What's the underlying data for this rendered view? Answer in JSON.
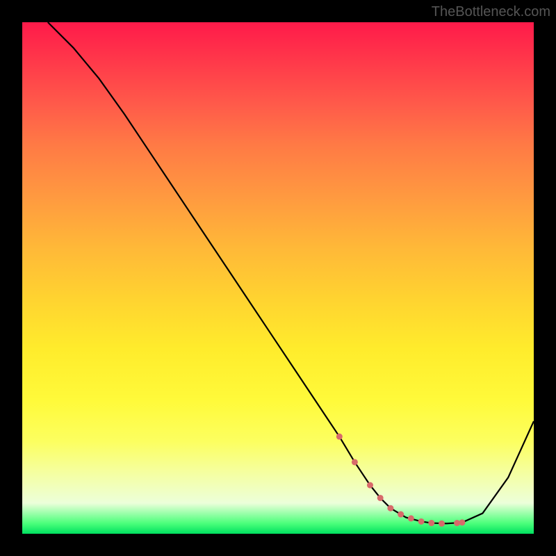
{
  "watermark": "TheBottleneck.com",
  "chart_data": {
    "type": "line",
    "title": "",
    "xlabel": "",
    "ylabel": "",
    "xlim": [
      0,
      100
    ],
    "ylim": [
      0,
      100
    ],
    "grid": false,
    "legend": false,
    "background": {
      "style": "vertical-gradient",
      "stops": [
        {
          "pos": 0,
          "color": "#ff1a4a"
        },
        {
          "pos": 50,
          "color": "#ffd330"
        },
        {
          "pos": 90,
          "color": "#f5ffa0"
        },
        {
          "pos": 100,
          "color": "#00e060"
        }
      ]
    },
    "series": [
      {
        "name": "bottleneck-curve",
        "color": "#000000",
        "x": [
          5,
          10,
          15,
          20,
          25,
          30,
          35,
          40,
          45,
          50,
          55,
          60,
          62,
          65,
          68,
          70,
          72,
          75,
          78,
          80,
          83,
          86,
          90,
          95,
          100
        ],
        "values": [
          100,
          95,
          89,
          82,
          74.5,
          67,
          59.5,
          52,
          44.5,
          37,
          29.5,
          22,
          19,
          14,
          9.5,
          7,
          5,
          3.2,
          2.4,
          2.1,
          2.0,
          2.2,
          4,
          11,
          22
        ]
      }
    ],
    "markers": {
      "name": "highlight-dots",
      "color": "#d86a6a",
      "x": [
        62,
        65,
        68,
        70,
        72,
        74,
        76,
        78,
        80,
        82,
        85,
        86
      ],
      "values": [
        19,
        14,
        9.5,
        7,
        5,
        3.8,
        3.0,
        2.4,
        2.1,
        2.0,
        2.1,
        2.2
      ]
    }
  }
}
